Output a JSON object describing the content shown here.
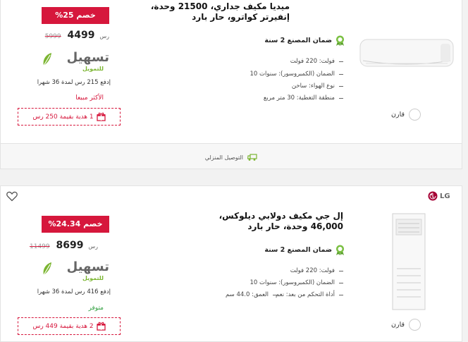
{
  "products": [
    {
      "discount": "%25 خصم",
      "price": "4499",
      "currency": "رس",
      "old_price": "5999",
      "financing_brand": "تسهيل",
      "financing_sub": "للتمويل",
      "installment": "إدفع 215 رس لمدة 36 شهرا",
      "badge": "الأكثر مبيعا",
      "gift": "1 هدية بقيمة 250 رس",
      "title_line1": "ميديا مكيف جداري، 21500 وحدة،",
      "title_line2": "إنفيرتر كواترو، حار بارد",
      "warranty": "ضمان المصنع 2 سنة",
      "specs": [
        "فولت: 220 فولت",
        "الضمان (الكمبروسور): سنوات 10",
        "نوع الهواء: ساخن",
        "منطقة التغطية: 30 متر مربع"
      ],
      "compare": "قارن"
    },
    {
      "brand": "LG",
      "discount": "%24.34 خصم",
      "price": "8699",
      "currency": "رس",
      "old_price": "11499",
      "financing_brand": "تسهيل",
      "financing_sub": "للتمويل",
      "installment": "إدفع 416 رس لمدة 36 شهرا",
      "badge": "متوفر",
      "gift": "2 هدية بقيمة 449 رس",
      "title_line1": "إل جي مكيف دولابي ديلوكس،",
      "title_line2": "46,000 وحدة، حار بارد",
      "warranty": "ضمان المصنع 2 سنة",
      "specs": [
        "فولت: 220 فولت",
        "الضمان (الكمبروسور): سنوات 10"
      ],
      "specs_pair": [
        "أداة التحكم من بعد: نعم",
        "العمق: 44.0 سم"
      ],
      "compare": "قارن"
    }
  ],
  "delivery": {
    "label": "التوصيل المنزلي"
  },
  "colors": {
    "accent": "#d6173c",
    "leaf": "#7bb531",
    "badge_red": "#d6173c",
    "badge_green": "#2e9e3e"
  }
}
